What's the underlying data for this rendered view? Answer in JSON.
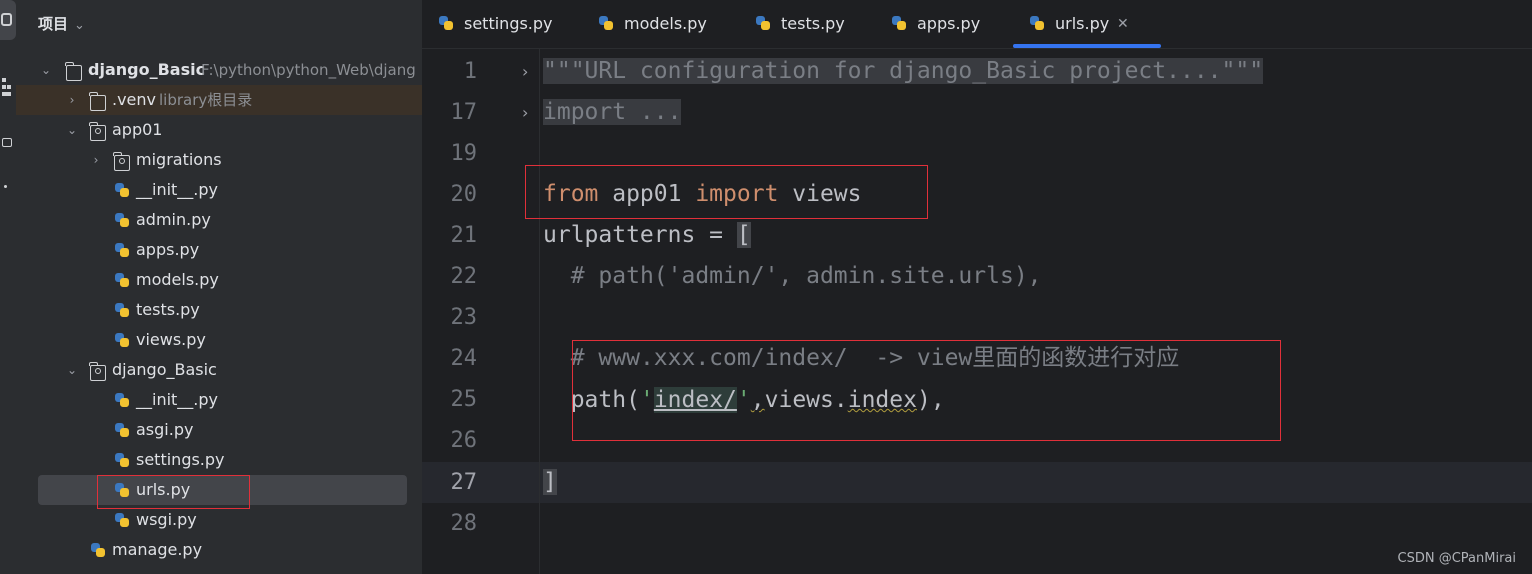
{
  "project_panel": {
    "title": "项目",
    "root": {
      "name": "django_Basic",
      "path": "F:\\python\\python_Web\\djang"
    },
    "venv": {
      "name": ".venv",
      "hint": "library根目录"
    },
    "items": [
      "app01",
      "migrations",
      "__init__.py",
      "admin.py",
      "apps.py",
      "models.py",
      "tests.py",
      "views.py",
      "django_Basic",
      "__init__.py",
      "asgi.py",
      "settings.py",
      "urls.py",
      "wsgi.py",
      "manage.py"
    ],
    "selected": "urls.py"
  },
  "tabs": [
    "settings.py",
    "models.py",
    "tests.py",
    "apps.py",
    "urls.py"
  ],
  "active_tab": "urls.py",
  "editor": {
    "line_numbers": [
      "1",
      "17",
      "19",
      "20",
      "21",
      "22",
      "23",
      "24",
      "25",
      "26",
      "27",
      "28"
    ],
    "current_line": "27",
    "lines": {
      "l1": "\"\"\"URL configuration for django_Basic project....\"\"\"",
      "l17": "import ...",
      "l20_kw1": "from",
      "l20_mod": " app01 ",
      "l20_kw2": "import",
      "l20_name": " views",
      "l21_name": "urlpatterns = ",
      "l21_bracket": "[",
      "l22": "# path('admin/', admin.site.urls),",
      "l24": "# www.xxx.com/index/  -> view里面的函数进行对应",
      "l25_pre": "path(",
      "l25_q1": "'",
      "l25_str": "index/",
      "l25_q2": "'",
      "l25_comma": ",",
      "l25_mid": "views.",
      "l25_index": "index",
      "l25_end": "),",
      "l27": "]"
    }
  },
  "watermark": "CSDN @CPanMirai",
  "colors": {
    "accent": "#3574f0",
    "highlight_box": "#e0303a",
    "keyword": "#cf8e6d",
    "comment": "#7a7e85",
    "string": "#6aab73"
  }
}
